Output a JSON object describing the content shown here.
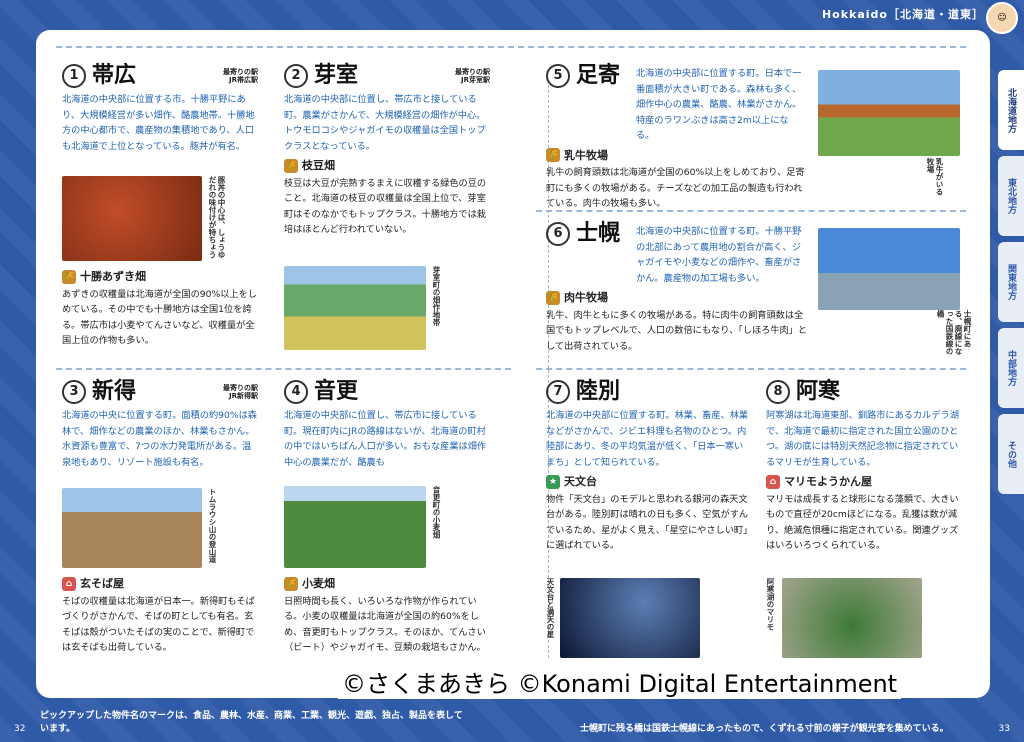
{
  "header": {
    "region": "Hokkaido［北海道・道東］"
  },
  "tabs": [
    "北海道地方",
    "東北地方",
    "関東地方",
    "中部地方",
    "その他"
  ],
  "s1": {
    "num": "1",
    "name": "帯広",
    "note1": "最寄りの駅",
    "note2": "JR帯広駅",
    "text": "北海道の中央部に位置する市。十勝平野にあり、大規模経営が多い畑作、酪農地帯。十勝地方の中心都市で、農産物の集積地であり、人口も北海道で上位となっている。豚丼が有名。",
    "sub": "十勝あずき畑",
    "subtext": "あずきの収穫量は北海道が全国の90%以上をしめている。その中でも十勝地方は全国1位を誇る。帯広市は小麦やてんさいなど、収穫量が全国上位の作物も多い。",
    "cap": "豚丼の中心は、しょうゆだれの味付けが特ちょう"
  },
  "s2": {
    "num": "2",
    "name": "芽室",
    "note1": "最寄りの駅",
    "note2": "JR芽室駅",
    "text": "北海道の中央部に位置し、帯広市と接している町。農業がさかんで、大規模経営の畑作が中心。トウモロコシやジャガイモの収穫量は全国トップクラスとなっている。",
    "sub": "枝豆畑",
    "subtext": "枝豆は大豆が完熟するまえに収穫する緑色の豆のこと。北海道の枝豆の収穫量は全国上位で、芽室町はそのなかでもトップクラス。十勝地方では栽培はほとんど行われていない。",
    "cap": "芽室町の畑作地帯"
  },
  "s3": {
    "num": "3",
    "name": "新得",
    "note1": "最寄りの駅",
    "note2": "JR新得駅",
    "text": "北海道の中央に位置する町。面積の約90%は森林で、畑作などの農業のほか、林業もさかん。水資源も豊富で、7つの水力発電所がある。温泉地もあり、リゾート施設も有名。",
    "sub": "玄そば屋",
    "subtext": "そばの収穫量は北海道が日本一。新得町もそばづくりがさかんで、そばの町としても有名。玄そばは殻がついたそばの実のことで、新得町では玄そばも出荷している。",
    "cap": "トムラウシ山の登山道"
  },
  "s4": {
    "num": "4",
    "name": "音更",
    "text": "北海道の中央部に位置し、帯広市に接している町。現在町内にJRの路線はないが、北海道の町村の中ではいちばん人口が多い。おもな産業は畑作中心の農業だが、酪農も",
    "sub": "小麦畑",
    "subtext": "日照時間も長く、いろいろな作物が作られている。小麦の収穫量は北海道が全国の約60%をしめ、音更町もトップクラス。そのほか、てんさい（ビート）やジャガイモ、豆類の栽培もさかん。",
    "cap": "音更町の小麦畑"
  },
  "s5": {
    "num": "5",
    "name": "足寄",
    "text": "北海道の中央部に位置する町。日本で一番面積が大きい町である。森林も多く、畑作中心の農業、酪農、林業がさかん。特産のラワンぶきは高さ2m以上になる。",
    "sub": "乳牛牧場",
    "subtext": "乳牛の飼育頭数は北海道が全国の60%以上をしめており、足寄町にも多くの牧場がある。チーズなどの加工品の製造も行われている。肉牛の牧場も多い。",
    "cap": "乳牛がいる牧場"
  },
  "s6": {
    "num": "6",
    "name": "士幌",
    "text": "北海道の中央部に位置する町。十勝平野の北部にあって農用地の割合が高く、ジャガイモや小麦などの畑作や、畜産がさかん。農産物の加工場も多い。",
    "sub": "肉牛牧場",
    "subtext": "乳牛、肉牛ともに多くの牧場がある。特に肉牛の飼育頭数は全国でもトップレベルで、人口の数倍にもなり、「しほろ牛肉」として出荷されている。",
    "cap": "士幌町にある、廃線になった国鉄線の橋"
  },
  "s7": {
    "num": "7",
    "name": "陸別",
    "text": "北海道の中央部に位置する町。林業、畜産、林業などがさかんで、ジビエ料理も名物のひとつ。内陸部にあり、冬の平均気温が低く、「日本一寒いまち」として知られている。",
    "sub": "天文台",
    "subtext": "物件「天文台」のモデルと思われる銀河の森天文台がある。陸別町は晴れの日も多く、空気がすんでいるため、星がよく見え、「星空にやさしい町」に選ばれている。",
    "cap": "天文台と満天の星"
  },
  "s8": {
    "num": "8",
    "name": "阿寒",
    "text": "阿寒湖は北海道東部、釧路市にあるカルデラ湖で、北海道で最初に指定された国立公園のひとつ。湖の底には特別天然記念物に指定されているマリモが生育している。",
    "sub": "マリモようかん屋",
    "subtext": "マリモは成長すると球形になる藻類で、大きいもので直径が20cmほどになる。乱獲は数が減り、絶滅危惧種に指定されている。関連グッズはいろいろつくられている。",
    "cap": "阿寒湖のマリモ"
  },
  "copyright": "©さくまあきら ©Konami Digital Entertainment",
  "footer_left": "ピックアップした物件名のマークは、食品、農林、水産、商業、工業、観光、遊戯、独占、製品を表しています。",
  "footer_right": "士幌町に残る橋は国鉄士幌線にあったもので、くずれる寸前の様子が観光客を集めている。",
  "page_left": "32",
  "page_right": "33",
  "colors": {
    "accent": "#2f5aa8",
    "icon_green": "#c98a2a",
    "icon_red": "#d9534f",
    "icon_teal": "#3a9a57"
  }
}
